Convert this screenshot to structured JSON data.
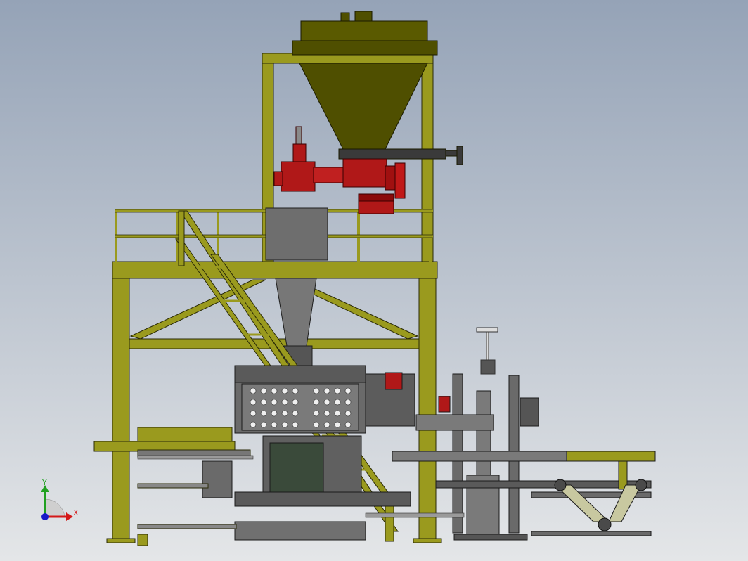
{
  "scene": {
    "background_top": "#95a3b7",
    "background_bottom": "#e4e6e8",
    "frame_color": "#9a9a1e",
    "frame_edge": "#2a2a08",
    "hopper_color": "#4f4f00",
    "feeder_color": "#b01818",
    "machine_color": "#6a6a6a",
    "machine_dark": "#3c3c3c"
  },
  "triad": {
    "x_label": "X",
    "y_label": "Y",
    "x_color": "#d41818",
    "y_color": "#20a020",
    "z_color": "#1818c8"
  }
}
